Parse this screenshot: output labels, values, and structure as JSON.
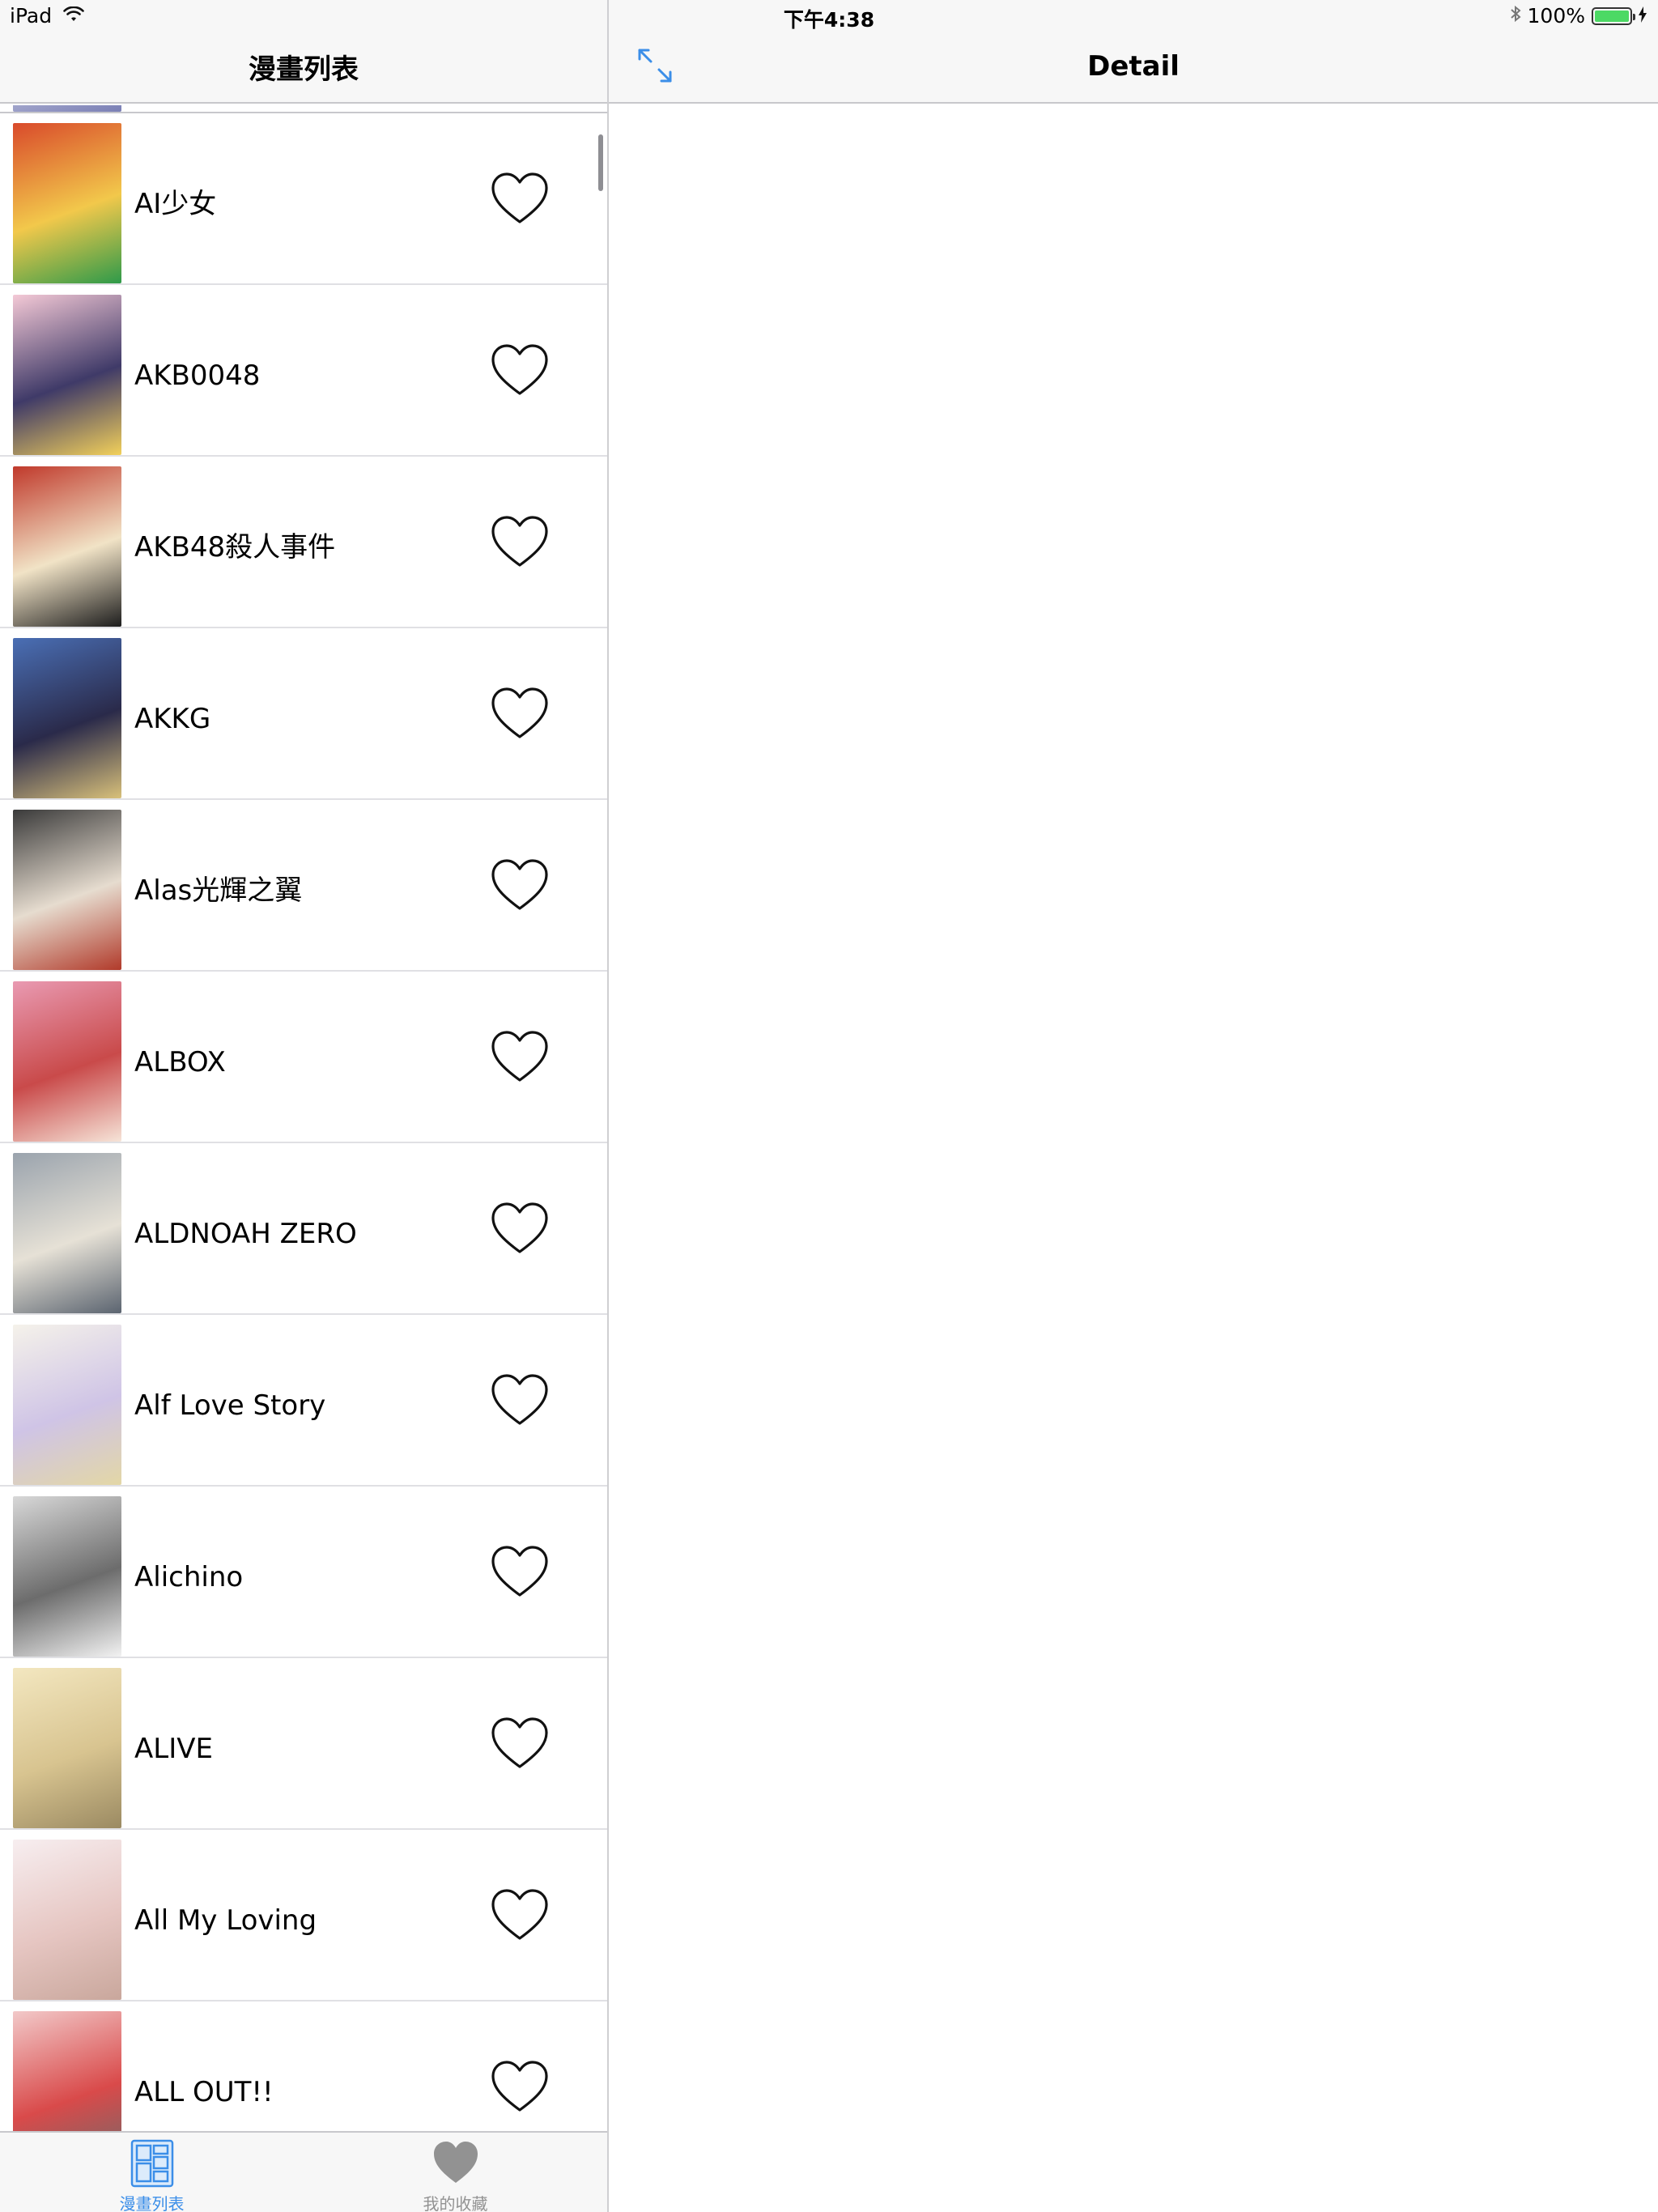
{
  "status_bar": {
    "device": "iPad",
    "time": "下午4:38",
    "battery": "100%",
    "battery_level": 1.0,
    "icons": [
      "wifi-icon",
      "bluetooth-icon",
      "battery-icon",
      "charging-bolt-icon"
    ]
  },
  "master": {
    "nav_title": "漫畫列表",
    "items": [
      {
        "title": "AI少女",
        "favorited": false,
        "cover_colors": [
          "#d94a2b",
          "#f2c84b",
          "#2e9a4a"
        ]
      },
      {
        "title": "AKB0048",
        "favorited": false,
        "cover_colors": [
          "#f4c9d6",
          "#3f3a68",
          "#f2d05a"
        ]
      },
      {
        "title": "AKB48殺人事件",
        "favorited": false,
        "cover_colors": [
          "#c0392b",
          "#f1e3c6",
          "#1d1d1d"
        ]
      },
      {
        "title": "AKKG",
        "favorited": false,
        "cover_colors": [
          "#4a6fb5",
          "#2a2a4a",
          "#d8c07a"
        ]
      },
      {
        "title": "Alas光輝之翼",
        "favorited": false,
        "cover_colors": [
          "#3a3a3a",
          "#e6dccf",
          "#b13a2a"
        ]
      },
      {
        "title": "ALBOX",
        "favorited": false,
        "cover_colors": [
          "#e99ab2",
          "#c94a4a",
          "#f6e4d8"
        ]
      },
      {
        "title": "ALDNOAH ZERO",
        "favorited": false,
        "cover_colors": [
          "#9aa3ad",
          "#e6e1d6",
          "#5b6470"
        ]
      },
      {
        "title": "Alf Love Story",
        "favorited": false,
        "cover_colors": [
          "#f5f2ea",
          "#cfc4e6",
          "#e3d7a6"
        ]
      },
      {
        "title": "Alichino",
        "favorited": false,
        "cover_colors": [
          "#d8d8d8",
          "#6c6c6c",
          "#f2f2f2"
        ]
      },
      {
        "title": "ALIVE",
        "favorited": false,
        "cover_colors": [
          "#f3e7c0",
          "#d8c490",
          "#9b8a62"
        ]
      },
      {
        "title": "All My Loving",
        "favorited": false,
        "cover_colors": [
          "#f7eef0",
          "#e6c6c2",
          "#c9a79c"
        ]
      },
      {
        "title": "ALL OUT!!",
        "favorited": false,
        "cover_colors": [
          "#f2c9c9",
          "#d94a4a",
          "#6b6b6b"
        ]
      }
    ],
    "partial_cover_colors": [
      "#3a3f7a",
      "#c6c8e0",
      "#7a7fb5"
    ]
  },
  "tab_bar": {
    "tabs": [
      {
        "label": "漫畫列表",
        "active": true,
        "icon": "comic-list-icon"
      },
      {
        "label": "我的收藏",
        "active": false,
        "icon": "heart-filled-icon"
      }
    ]
  },
  "detail": {
    "nav_title": "Detail",
    "expand_icon": "expand-arrows-icon"
  },
  "colors": {
    "accent": "#3b8ee8",
    "inactive": "#929292",
    "bar_background": "#f7f7f7",
    "separator": "#c8c8cc"
  }
}
